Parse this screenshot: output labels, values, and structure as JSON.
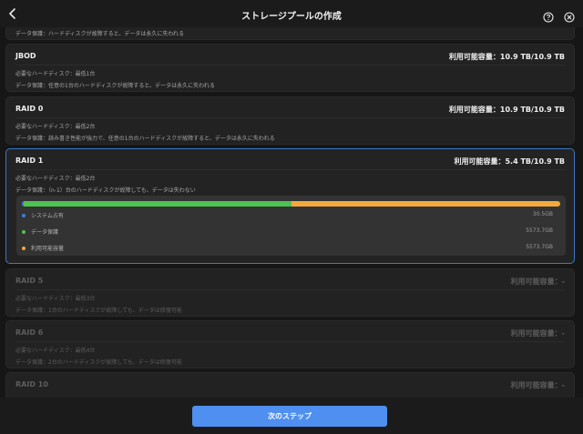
{
  "header": {
    "title": "ストレージプールの作成"
  },
  "cards": [
    {
      "title": "",
      "capacity": "",
      "lines": [
        "データ保護：ハードディスクが故障すると、データは永久に失われる"
      ]
    },
    {
      "title": "JBOD",
      "capacity": "利用可能容量：10.9 TB/10.9 TB",
      "lines": [
        "必要なハードディスク：最低1台",
        "データ保護：任意の1台のハードディスクが故障すると、データは永久に失われる"
      ]
    },
    {
      "title": "RAID 0",
      "capacity": "利用可能容量：10.9 TB/10.9 TB",
      "lines": [
        "必要なハードディスク：最低2台",
        "データ保護：読み書き性能が強力で、任意の1台のハードディスクが故障すると、データは永久に失われる"
      ]
    },
    {
      "title": "RAID 1",
      "capacity": "利用可能容量：5.4 TB/10.9 TB",
      "lines": [
        "必要なハードディスク：最低2台",
        "データ保護：（n-1）台のハードディスクが故障しても、データは失わない"
      ]
    },
    {
      "title": "RAID 5",
      "capacity": "利用可能容量：-",
      "lines": [
        "必要なハードディスク：最低3台",
        "データ保護：1台のハードディスクが故障しても、データは修復可能"
      ]
    },
    {
      "title": "RAID 6",
      "capacity": "利用可能容量：-",
      "lines": [
        "必要なハードディスク：最低4台",
        "データ保護：2台のハードディスクが故障しても、データは修復可能"
      ]
    },
    {
      "title": "RAID 10",
      "capacity": "利用可能容量：-",
      "lines": []
    }
  ],
  "usage": {
    "legend": [
      {
        "label": "システム占有",
        "value": "30.5GB",
        "color": "#3d7ee0"
      },
      {
        "label": "データ保護",
        "value": "5573.7GB",
        "color": "#4fc24f"
      },
      {
        "label": "利用可能容量",
        "value": "5573.7GB",
        "color": "#f4a93b"
      }
    ],
    "fractions": [
      0.003,
      0.4985,
      0.4985
    ]
  },
  "footer": {
    "next_label": "次のステップ"
  },
  "icons": {
    "back": "chevron-left-icon",
    "help": "help-circle-icon",
    "close": "close-circle-icon"
  }
}
